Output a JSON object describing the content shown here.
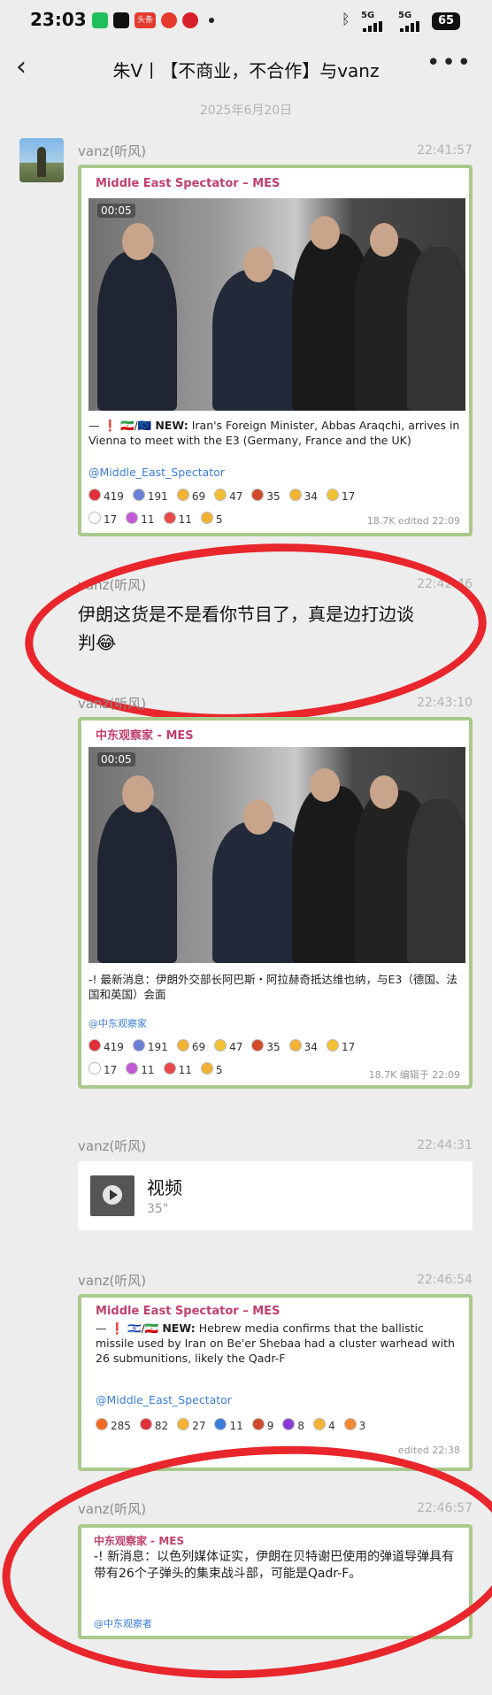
{
  "status_bar": {
    "time": "23:03",
    "app_badge": "头条",
    "network_1": "5G",
    "network_2": "5G",
    "battery": "65"
  },
  "nav": {
    "back_icon": "chevron-left-icon",
    "title": "朱V丨【不商业，不合作】与vanz",
    "more_icon": "more-dots-icon"
  },
  "date_separator": "2025年6月20日",
  "messages": [
    {
      "sender": "vanz(听风)",
      "time": "22:41:57",
      "card": {
        "source": "Middle East Spectator – MES",
        "video_time": "00:05",
        "caption_prefix": "— ❗ 🇮🇷/🇪🇺 ",
        "caption_bold": "NEW:",
        "caption": " Iran's Foreign Minister, Abbas Araqchi, arrives in Vienna to meet with the E3 (Germany, France and the UK)",
        "handle": "@Middle_East_Spectator",
        "reactions_row1": [
          {
            "emoji": "❤️",
            "count": "419",
            "color": "#e0303a"
          },
          {
            "emoji": "🙏",
            "count": "191",
            "color": "#6a7fd6"
          },
          {
            "emoji": "👎",
            "count": "69",
            "color": "#f2b233"
          },
          {
            "emoji": "🤔",
            "count": "47",
            "color": "#f2c033"
          },
          {
            "emoji": "🤬",
            "count": "35",
            "color": "#d24a2a"
          },
          {
            "emoji": "👍",
            "count": "34",
            "color": "#f2b233"
          },
          {
            "emoji": "🤣",
            "count": "17",
            "color": "#f2c033"
          }
        ],
        "reactions_row2": [
          {
            "emoji": "👀",
            "count": "17",
            "color": "#ffffff"
          },
          {
            "emoji": "💅",
            "count": "11",
            "color": "#c35bd6"
          },
          {
            "emoji": "💊",
            "count": "11",
            "color": "#e64a4a"
          },
          {
            "emoji": "🙏",
            "count": "5",
            "color": "#f2b233"
          }
        ],
        "views": "18.7K  edited 22:09"
      }
    },
    {
      "sender": "vanz(听风)",
      "time": "22:42:46",
      "text_line1": "伊朗这货是不是看你节目了，真是边打边谈",
      "text_line2": "判😂"
    },
    {
      "sender": "vanz(听风)",
      "time": "22:43:10",
      "card": {
        "source": "中东观察家 - MES",
        "video_time": "00:05",
        "caption": "-! 最新消息：伊朗外交部长阿巴斯・阿拉赫奇抵达维也纳，与E3（德国、法国和英国）会面",
        "handle": "@中东观察家",
        "reactions_row1": [
          {
            "emoji": "❤️",
            "count": "419",
            "color": "#e0303a"
          },
          {
            "emoji": "🙏",
            "count": "191",
            "color": "#6a7fd6"
          },
          {
            "emoji": "👎",
            "count": "69",
            "color": "#f2b233"
          },
          {
            "emoji": "🤔",
            "count": "47",
            "color": "#f2c033"
          },
          {
            "emoji": "🤬",
            "count": "35",
            "color": "#d24a2a"
          },
          {
            "emoji": "👍",
            "count": "34",
            "color": "#f2b233"
          },
          {
            "emoji": "🤣",
            "count": "17",
            "color": "#f2c033"
          }
        ],
        "reactions_row2": [
          {
            "emoji": "👀",
            "count": "17",
            "color": "#ffffff"
          },
          {
            "emoji": "💅",
            "count": "11",
            "color": "#c35bd6"
          },
          {
            "emoji": "💊",
            "count": "11",
            "color": "#e64a4a"
          },
          {
            "emoji": "🙏",
            "count": "5",
            "color": "#f2b233"
          }
        ],
        "views": "18.7K 编辑于 22:09"
      }
    },
    {
      "sender": "vanz(听风)",
      "time": "22:44:31",
      "video_label": "视频",
      "duration": "35\""
    },
    {
      "sender": "vanz(听风)",
      "time": "22:46:54",
      "card": {
        "source": "Middle East Spectator – MES",
        "caption_prefix": "— ❗ 🇮🇱/🇮🇷 ",
        "caption_bold": "NEW:",
        "caption": " Hebrew media confirms that the ballistic missile used by Iran on Be'er Shebaa had a cluster warhead with 26 submunitions, likely the Qadr-F",
        "handle": "@Middle_East_Spectator",
        "reactions_row1": [
          {
            "emoji": "🔥",
            "count": "285",
            "color": "#f26a22"
          },
          {
            "emoji": "❤️",
            "count": "82",
            "color": "#e0303a"
          },
          {
            "emoji": "👏",
            "count": "27",
            "color": "#f2b233"
          },
          {
            "emoji": "🆒",
            "count": "11",
            "color": "#3b7ddb"
          },
          {
            "emoji": "🤬",
            "count": "9",
            "color": "#d24a2a"
          },
          {
            "emoji": "😈",
            "count": "8",
            "color": "#8a3bd6"
          },
          {
            "emoji": "👍",
            "count": "4",
            "color": "#f2b233"
          },
          {
            "emoji": "🥰",
            "count": "3",
            "color": "#f28a33"
          }
        ],
        "views": "edited 22:38"
      }
    },
    {
      "sender": "vanz(听风)",
      "time": "22:46:57",
      "card": {
        "source": "中东观察家 - MES",
        "caption": "-! 新消息：以色列媒体证实，伊朗在贝特谢巴使用的弹道导弹具有带有26个子弹头的集束战斗部，可能是Qadr-F。",
        "handle": "@中东观察者"
      }
    }
  ],
  "annotations": {
    "circle_color": "#e8262c"
  }
}
